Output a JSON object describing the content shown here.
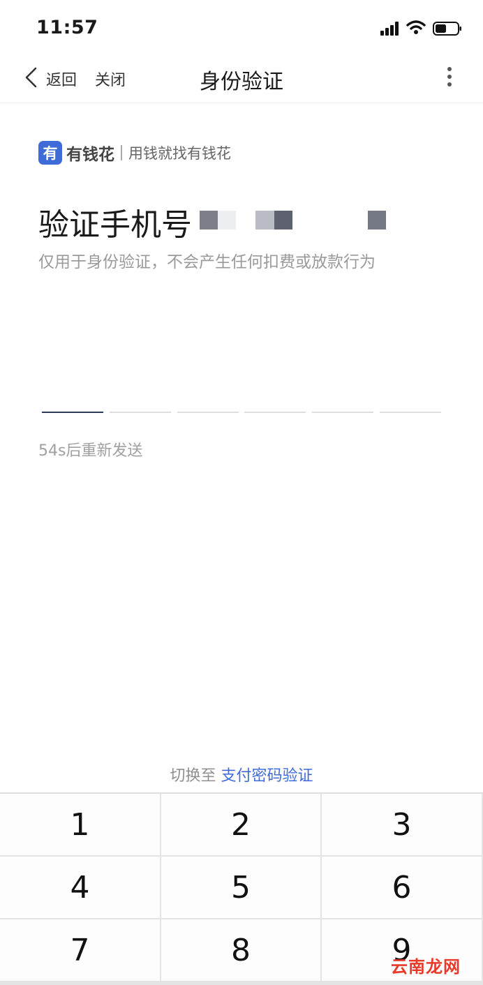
{
  "status_bar": {
    "time": "11:57",
    "signal_icon": "cellular-signal-icon",
    "wifi_icon": "wifi-icon",
    "battery_icon": "battery-icon",
    "battery_level": 0.5
  },
  "nav": {
    "back_icon": "chevron-left-icon",
    "back_label": "返回",
    "close_label": "关闭",
    "title": "身份验证",
    "more_icon": "more-vertical-icon"
  },
  "brand": {
    "logo_glyph": "有",
    "name": "有钱花",
    "slogan": "用钱就找有钱花",
    "brand_color": "#3f6bd8"
  },
  "verify": {
    "heading": "验证手机号",
    "subtitle": "仅用于身份验证，不会产生任何扣费或放款行为",
    "code_length": 6,
    "active_slot": 1,
    "resend_text": "54s后重新发送"
  },
  "switch": {
    "prefix": "切换至",
    "link": "支付密码验证",
    "link_color": "#3f6bd8"
  },
  "keypad": {
    "keys": [
      "1",
      "2",
      "3",
      "4",
      "5",
      "6",
      "7",
      "8",
      "9"
    ]
  },
  "watermark": {
    "text": "云南龙网"
  }
}
